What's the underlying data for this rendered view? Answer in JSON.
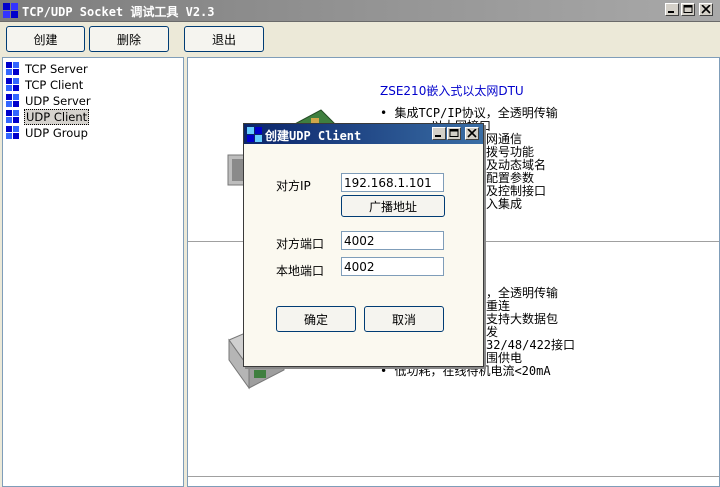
{
  "window": {
    "title": "TCP/UDP Socket 调试工具 V2.3"
  },
  "toolbar": {
    "create_label": "创建",
    "delete_label": "删除",
    "exit_label": "退出"
  },
  "tree": {
    "items": [
      "TCP Server",
      "TCP Client",
      "UDP Server",
      "UDP Client",
      "UDP Group"
    ],
    "selected": "UDP Client"
  },
  "content": {
    "product1_title": "ZSE210嵌入式以太网DTU",
    "product1_features": [
      "• 集成TCP/IP协议，全透明传输",
      "以太网接口",
      "网通信",
      "拨号功能",
      "及动态域名",
      "配置参数",
      "及控制接口",
      "入集成"
    ],
    "product2_features": [
      "，全透明传输",
      "重连",
      "支持大数据包",
      "发",
      "32/48/422接口",
      "围供电",
      "• 低功耗，在线待机电流<20mA"
    ]
  },
  "dialog": {
    "title": "创建UDP Client",
    "remote_ip_label": "对方IP",
    "remote_ip_value": "192.168.1.101",
    "broadcast_label": "广播地址",
    "remote_port_label": "对方端口",
    "remote_port_value": "4002",
    "local_port_label": "本地端口",
    "local_port_value": "4002",
    "ok_label": "确定",
    "cancel_label": "取消"
  },
  "colors": {
    "dialog_title": "#0a246a",
    "link_blue": "#0000cc"
  }
}
